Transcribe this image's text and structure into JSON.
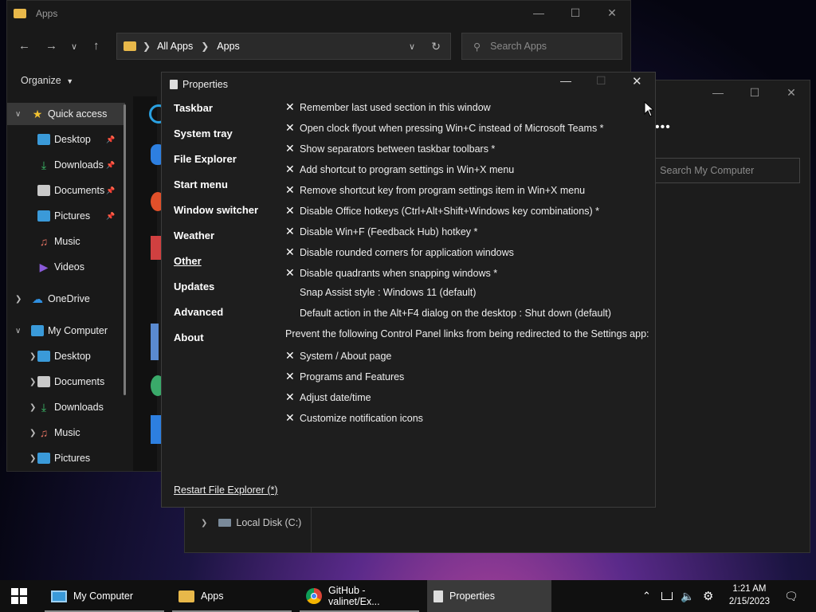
{
  "explorer": {
    "title": "Apps",
    "breadcrumb": [
      "All Apps",
      "Apps"
    ],
    "search_placeholder": "Search Apps",
    "organize_label": "Organize",
    "sidebar": [
      {
        "label": "Quick access",
        "level": 0,
        "expanded": true,
        "icon": "star-icon",
        "color": "#f2c230",
        "active": true
      },
      {
        "label": "Desktop",
        "level": 1,
        "icon": "desktop-icon",
        "color": "#3a9ad9",
        "pinned": true
      },
      {
        "label": "Downloads",
        "level": 1,
        "icon": "download-icon",
        "color": "#3cbf6a",
        "pinned": true
      },
      {
        "label": "Documents",
        "level": 1,
        "icon": "document-icon",
        "color": "#c9c9c9",
        "pinned": true
      },
      {
        "label": "Pictures",
        "level": 1,
        "icon": "picture-icon",
        "color": "#3a9ad9",
        "pinned": true
      },
      {
        "label": "Music",
        "level": 1,
        "icon": "music-icon",
        "color": "#e07060"
      },
      {
        "label": "Videos",
        "level": 1,
        "icon": "video-icon",
        "color": "#8a5ad9"
      },
      {
        "label": "OneDrive",
        "level": 0,
        "expanded": false,
        "icon": "cloud-icon",
        "color": "#2f8fe0"
      },
      {
        "label": "My Computer",
        "level": 0,
        "expanded": true,
        "icon": "computer-icon",
        "color": "#3a9ad9"
      },
      {
        "label": "Desktop",
        "level": 1,
        "expandable": true,
        "icon": "desktop-icon",
        "color": "#3a9ad9"
      },
      {
        "label": "Documents",
        "level": 1,
        "expandable": true,
        "icon": "document-icon",
        "color": "#c9c9c9"
      },
      {
        "label": "Downloads",
        "level": 1,
        "expandable": true,
        "icon": "download-icon",
        "color": "#3cbf6a"
      },
      {
        "label": "Music",
        "level": 1,
        "expandable": true,
        "icon": "music-icon",
        "color": "#e07060"
      },
      {
        "label": "Pictures",
        "level": 1,
        "expandable": true,
        "icon": "picture-icon",
        "color": "#3a9ad9"
      }
    ]
  },
  "mycomputer": {
    "search_placeholder": "Search My Computer",
    "local_disk": "Local Disk (C:)"
  },
  "properties": {
    "title": "Properties",
    "nav": [
      {
        "label": "Taskbar"
      },
      {
        "label": "System tray"
      },
      {
        "label": "File Explorer"
      },
      {
        "label": "Start menu"
      },
      {
        "label": "Window switcher"
      },
      {
        "label": "Weather"
      },
      {
        "label": "Other",
        "current": true
      },
      {
        "label": "Updates"
      },
      {
        "label": "Advanced"
      },
      {
        "label": "About"
      }
    ],
    "options": [
      {
        "checked": true,
        "text": "Remember last used section in this window"
      },
      {
        "checked": true,
        "text": "Open clock flyout when pressing Win+C instead of Microsoft Teams *"
      },
      {
        "checked": true,
        "text": "Show separators between taskbar toolbars *"
      },
      {
        "checked": true,
        "text": "Add shortcut to program settings in Win+X menu"
      },
      {
        "checked": true,
        "text": "Remove shortcut key from program settings item in Win+X menu"
      },
      {
        "checked": true,
        "text": "Disable Office hotkeys (Ctrl+Alt+Shift+Windows key combinations) *"
      },
      {
        "checked": true,
        "text": "Disable Win+F (Feedback Hub) hotkey *"
      },
      {
        "checked": true,
        "text": "Disable rounded corners for application windows"
      },
      {
        "checked": true,
        "text": "Disable quadrants when snapping windows *"
      },
      {
        "checked": false,
        "text": "Snap Assist style : Windows 11 (default)"
      },
      {
        "checked": false,
        "text": "Default action in the Alt+F4 dialog on the desktop : Shut down (default)"
      },
      {
        "heading": true,
        "text": "Prevent the following Control Panel links from being redirected to the Settings app:"
      },
      {
        "checked": true,
        "text": "System / About page"
      },
      {
        "checked": true,
        "text": "Programs and Features"
      },
      {
        "checked": true,
        "text": "Adjust date/time"
      },
      {
        "checked": true,
        "text": "Customize notification icons"
      }
    ],
    "restart_label": "Restart File Explorer (*)"
  },
  "taskbar": {
    "items": [
      {
        "label": "My Computer",
        "icon": "computer-icon"
      },
      {
        "label": "Apps",
        "icon": "folder-icon"
      },
      {
        "label": "GitHub - valinet/Ex...",
        "icon": "chrome-icon"
      },
      {
        "label": "Properties",
        "icon": "properties-icon",
        "active": true
      }
    ],
    "time": "1:21 AM",
    "date": "2/15/2023"
  }
}
